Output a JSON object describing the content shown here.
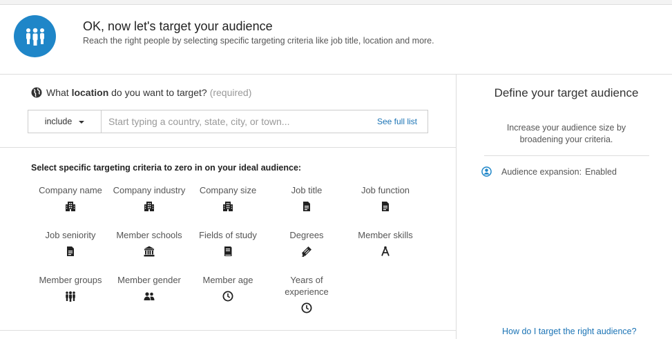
{
  "header": {
    "title": "OK, now let's target your audience",
    "subtitle": "Reach the right people by selecting specific targeting criteria like job title, location and more.",
    "icon": "people-group-icon"
  },
  "location": {
    "question_prefix": "What ",
    "question_bold": "location",
    "question_suffix": " do you want to target?",
    "required_label": "(required)",
    "include_label": "include",
    "placeholder": "Start typing a country, state, city, or town...",
    "see_full_list": "See full list"
  },
  "criteria": {
    "heading": "Select specific targeting criteria to zero in on your ideal audience:",
    "items": [
      {
        "label": "Company name",
        "icon": "building-icon"
      },
      {
        "label": "Company industry",
        "icon": "building-icon"
      },
      {
        "label": "Company size",
        "icon": "building-icon"
      },
      {
        "label": "Job title",
        "icon": "document-icon"
      },
      {
        "label": "Job function",
        "icon": "document-icon"
      },
      {
        "label": "Job seniority",
        "icon": "document-icon"
      },
      {
        "label": "Member schools",
        "icon": "school-icon"
      },
      {
        "label": "Fields of study",
        "icon": "book-icon"
      },
      {
        "label": "Degrees",
        "icon": "diploma-icon"
      },
      {
        "label": "Member skills",
        "icon": "compass-icon"
      },
      {
        "label": "Member groups",
        "icon": "people-group-icon"
      },
      {
        "label": "Member gender",
        "icon": "people-icon"
      },
      {
        "label": "Member age",
        "icon": "clock-icon"
      },
      {
        "label": "Years of experience",
        "icon": "clock-icon"
      }
    ]
  },
  "sidebar": {
    "title": "Define your target audience",
    "subtitle": "Increase your audience size by broadening your criteria.",
    "expansion_label": "Audience expansion:",
    "expansion_value": "Enabled",
    "help_link": "How do I target the right audience?"
  },
  "colors": {
    "brand": "#1f86c8",
    "link": "#1a73b5"
  }
}
